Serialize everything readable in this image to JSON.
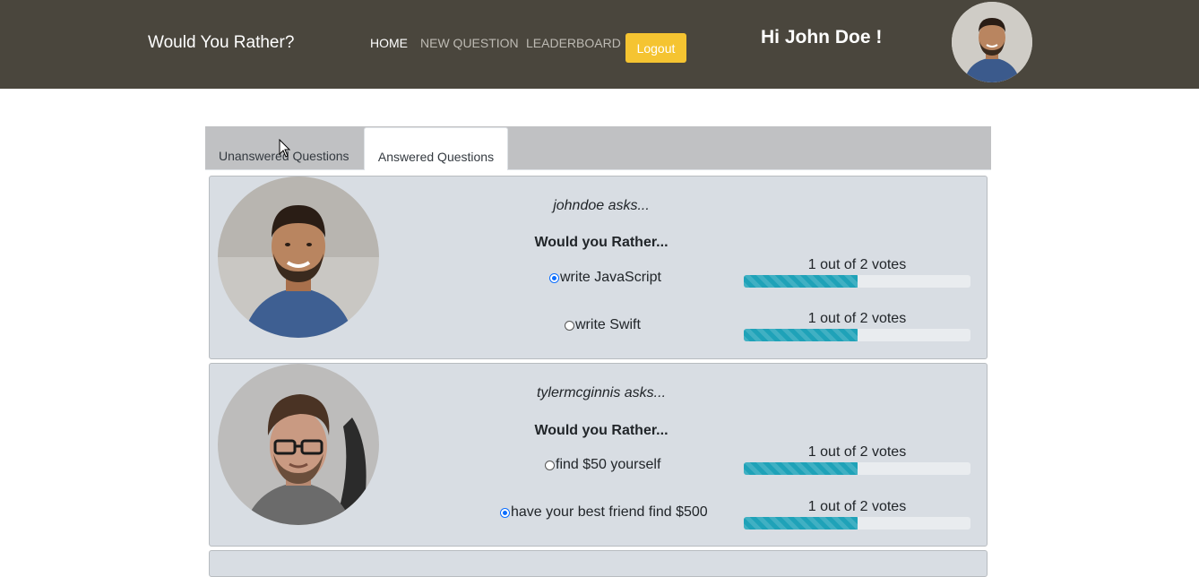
{
  "navbar": {
    "brand": "Would You Rather?",
    "links": [
      "HOME",
      "NEW QUESTION",
      "LEADERBOARD"
    ],
    "logout_label": "Logout",
    "greeting": "Hi John Doe !"
  },
  "tabs": {
    "unanswered": "Unanswered Questions",
    "answered": "Answered Questions",
    "active": "Answered Questions"
  },
  "questions": [
    {
      "asker": "johndoe asks...",
      "prompt": "Would you Rather...",
      "options": [
        {
          "text": "write JavaScript",
          "selected": true,
          "votes_text": "1 out of 2 votes",
          "fraction": 0.5
        },
        {
          "text": "write Swift",
          "selected": false,
          "votes_text": "1 out of 2 votes",
          "fraction": 0.5
        }
      ]
    },
    {
      "asker": "tylermcginnis asks...",
      "prompt": "Would you Rather...",
      "options": [
        {
          "text": "find $50 yourself",
          "selected": false,
          "votes_text": "1 out of 2 votes",
          "fraction": 0.5
        },
        {
          "text": "have your best friend find $500",
          "selected": true,
          "votes_text": "1 out of 2 votes",
          "fraction": 0.5
        }
      ]
    }
  ],
  "colors": {
    "navbar_bg": "#4a463d",
    "logout_bg": "#f5c431",
    "card_bg": "#d8dde3",
    "progress": "#1fa2b8"
  }
}
